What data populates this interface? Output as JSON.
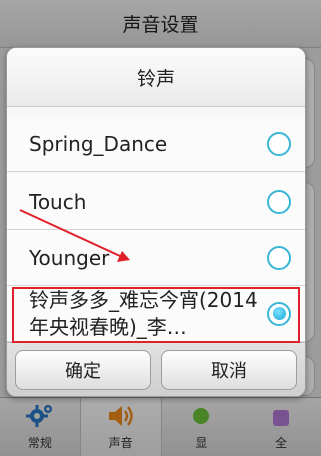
{
  "page": {
    "title": "声音设置"
  },
  "dialog": {
    "title": "铃声",
    "options": [
      {
        "label": "Spring_Dance",
        "selected": false
      },
      {
        "label": "Touch",
        "selected": false
      },
      {
        "label": "Younger",
        "selected": false
      },
      {
        "label": "铃声多多_难忘今宵(2014年央视春晚)_李…",
        "selected": true
      }
    ],
    "ok_label": "确定",
    "cancel_label": "取消"
  },
  "bottom_nav": {
    "items": [
      {
        "label": "常规",
        "icon": "gear-icon"
      },
      {
        "label": "声音",
        "icon": "speaker-icon",
        "active": true
      },
      {
        "label": "显",
        "icon": "sun-icon"
      },
      {
        "label": "安全",
        "icon": "lock-icon"
      }
    ],
    "right_label": "全"
  },
  "colors": {
    "radio_accent": "#38b6d6",
    "annotation_red": "#e0202a",
    "speaker_orange": "#f08a1a",
    "gear_blue": "#2a78c8"
  }
}
